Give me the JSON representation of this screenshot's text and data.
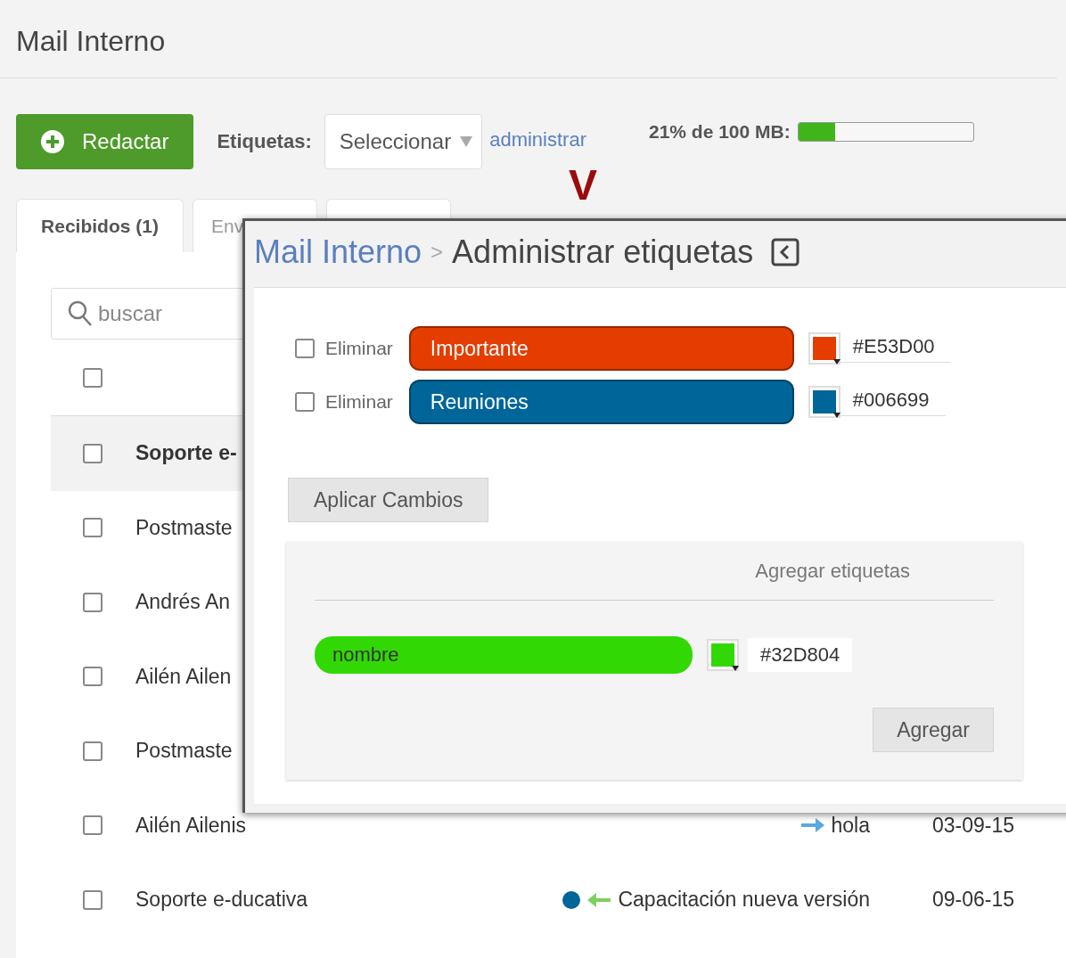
{
  "page_title": "Mail Interno",
  "toolbar": {
    "compose_button": "Redactar",
    "labels_caption": "Etiquetas:",
    "labels_select": {
      "value": "Seleccionar"
    },
    "manage_link": "administrar",
    "annotation_mark": "V",
    "quota": {
      "text": "21% de 100 MB:",
      "level": 0.21
    }
  },
  "tabs": [
    {
      "label": "Recibidos (1)",
      "selected": true
    },
    {
      "label": "Env",
      "selected": false
    },
    {
      "selected": false
    }
  ],
  "search": {
    "placeholder": "buscar"
  },
  "header": {
    "checked": false
  },
  "messages": [
    {
      "sender": "Soporte e-",
      "unread": true,
      "checked": false
    },
    {
      "sender": "Postmaste",
      "unread": false,
      "checked": false
    },
    {
      "sender": "Andrés An",
      "unread": false,
      "checked": false
    },
    {
      "sender": "Ailén Ailen",
      "unread": false,
      "checked": false
    },
    {
      "sender": "Postmaste",
      "unread": false,
      "checked": false
    },
    {
      "sender": "Ailén Ailenis",
      "unread": false,
      "checked": false,
      "kind": "forwarded",
      "subject": "hola",
      "date": "03-09-15"
    },
    {
      "sender": "Soporte e-ducativa",
      "unread": false,
      "checked": false,
      "color": "#006699",
      "kind": "replied",
      "subject": "Capacitación nueva versión",
      "date": "09-06-15"
    }
  ],
  "dialog": {
    "breadcrumb": "Mail Interno",
    "separator": ">",
    "title": "Administrar etiquetas",
    "labels": [
      {
        "delete_caption": "Eliminar",
        "checked": false,
        "name": "Importante",
        "color": "#e53d00",
        "hex": "#E53D00"
      },
      {
        "delete_caption": "Eliminar",
        "checked": false,
        "name": "Reuniones",
        "color": "#006699",
        "hex": "#006699"
      }
    ],
    "apply_button": "Aplicar Cambios",
    "add_section": {
      "heading": "Agregar etiquetas",
      "name_field": {
        "placeholder": "nombre"
      },
      "color": "#32d804",
      "hex": "#32D804",
      "add_button": "Agregar"
    }
  }
}
